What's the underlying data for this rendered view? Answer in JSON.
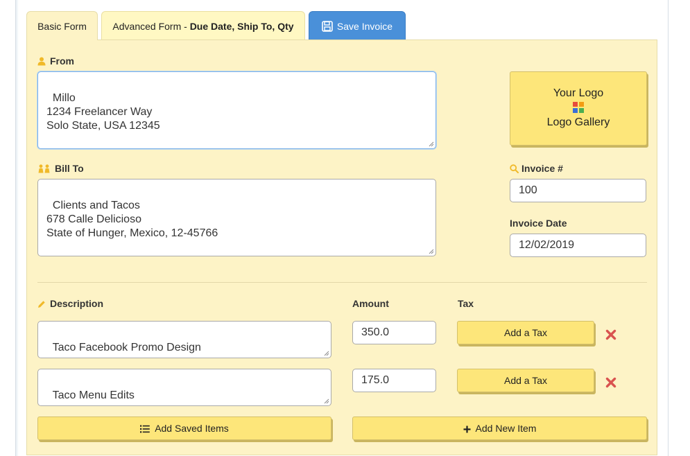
{
  "tabs": {
    "basic": "Basic Form",
    "advanced_prefix": "Advanced Form - ",
    "advanced_bold": "Due Date, Ship To, Qty",
    "save": "Save Invoice"
  },
  "from": {
    "label": "From",
    "value": "Millo\n1234 Freelancer Way\nSolo State, USA 12345"
  },
  "bill_to": {
    "label": "Bill To",
    "value": "Clients and Tacos\n678 Calle Delicioso\nState of Hunger, Mexico, 12-45766"
  },
  "logo": {
    "title": "Your Logo",
    "gallery": "Logo Gallery"
  },
  "invoice_number": {
    "label": "Invoice #",
    "value": "100"
  },
  "invoice_date": {
    "label": "Invoice Date",
    "value": "12/02/2019"
  },
  "items_header": {
    "description": "Description",
    "amount": "Amount",
    "tax": "Tax"
  },
  "items": [
    {
      "description": "Taco Facebook Promo Design",
      "amount": "350.0",
      "tax_button": "Add a Tax"
    },
    {
      "description": "Taco Menu Edits",
      "amount": "175.0",
      "tax_button": "Add a Tax"
    }
  ],
  "actions": {
    "add_saved": "Add Saved Items",
    "add_new": "Add New Item"
  },
  "colors": {
    "panel_bg": "#fdf3c6",
    "button_yellow": "#fde67a",
    "save_blue": "#4a90d9",
    "icon_yellow": "#f0b929",
    "delete_red": "#d9534f"
  }
}
